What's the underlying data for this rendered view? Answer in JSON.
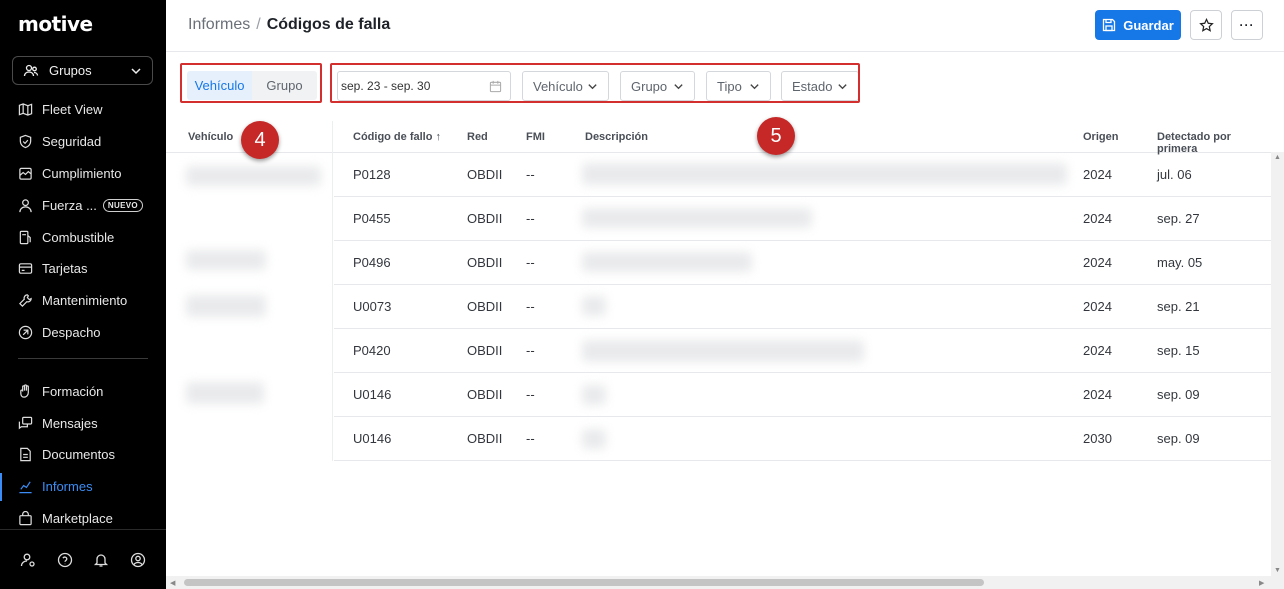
{
  "app": {
    "logo": "motive"
  },
  "sidebar": {
    "group_select": "Grupos",
    "items": [
      {
        "label": "Fleet View",
        "icon": "map-icon"
      },
      {
        "label": "Seguridad",
        "icon": "shield-icon"
      },
      {
        "label": "Cumplimiento",
        "icon": "clipboard-icon"
      },
      {
        "label": "Fuerza ...",
        "icon": "person-icon",
        "badge": "NUEVO"
      },
      {
        "label": "Combustible",
        "icon": "fuel-icon"
      },
      {
        "label": "Tarjetas",
        "icon": "card-icon"
      },
      {
        "label": "Mantenimiento",
        "icon": "wrench-icon"
      },
      {
        "label": "Despacho",
        "icon": "dispatch-icon"
      },
      {
        "label": "Formación",
        "icon": "hand-icon"
      },
      {
        "label": "Mensajes",
        "icon": "message-icon"
      },
      {
        "label": "Documentos",
        "icon": "document-icon"
      },
      {
        "label": "Informes",
        "icon": "chart-icon",
        "active": true
      },
      {
        "label": "Marketplace",
        "icon": "store-icon"
      }
    ]
  },
  "header": {
    "breadcrumb_parent": "Informes",
    "breadcrumb_sep": "/",
    "title": "Códigos de falla",
    "save_label": "Guardar",
    "more_label": "···"
  },
  "filters": {
    "segment": {
      "vehicle": "Vehículo",
      "group": "Grupo"
    },
    "date_range": "sep. 23 - sep. 30",
    "vehicle_dd": "Vehículo",
    "group_dd": "Grupo",
    "type_dd": "Tipo",
    "status_dd": "Estado"
  },
  "callouts": {
    "a": "4",
    "b": "5"
  },
  "table": {
    "headers": {
      "vehicle": "Vehículo",
      "code": "Código de fallo ↑",
      "network": "Red",
      "fmi": "FMI",
      "description": "Descripción",
      "origin": "Origen",
      "detected": "Detectado por primera"
    },
    "rows": [
      {
        "code": "P0128",
        "network": "OBDII",
        "fmi": "--",
        "origin": "2024",
        "detected": "jul. 06"
      },
      {
        "code": "P0455",
        "network": "OBDII",
        "fmi": "--",
        "origin": "2024",
        "detected": "sep. 27"
      },
      {
        "code": "P0496",
        "network": "OBDII",
        "fmi": "--",
        "origin": "2024",
        "detected": "may. 05"
      },
      {
        "code": "U0073",
        "network": "OBDII",
        "fmi": "--",
        "origin": "2024",
        "detected": "sep. 21"
      },
      {
        "code": "P0420",
        "network": "OBDII",
        "fmi": "--",
        "origin": "2024",
        "detected": "sep. 15"
      },
      {
        "code": "U0146",
        "network": "OBDII",
        "fmi": "--",
        "origin": "2024",
        "detected": "sep. 09"
      },
      {
        "code": "U0146",
        "network": "OBDII",
        "fmi": "--",
        "origin": "2030",
        "detected": "sep. 09"
      }
    ]
  },
  "colors": {
    "accent": "#1677e6",
    "highlight": "#d32f2f",
    "sidebar_bg": "#000000"
  }
}
